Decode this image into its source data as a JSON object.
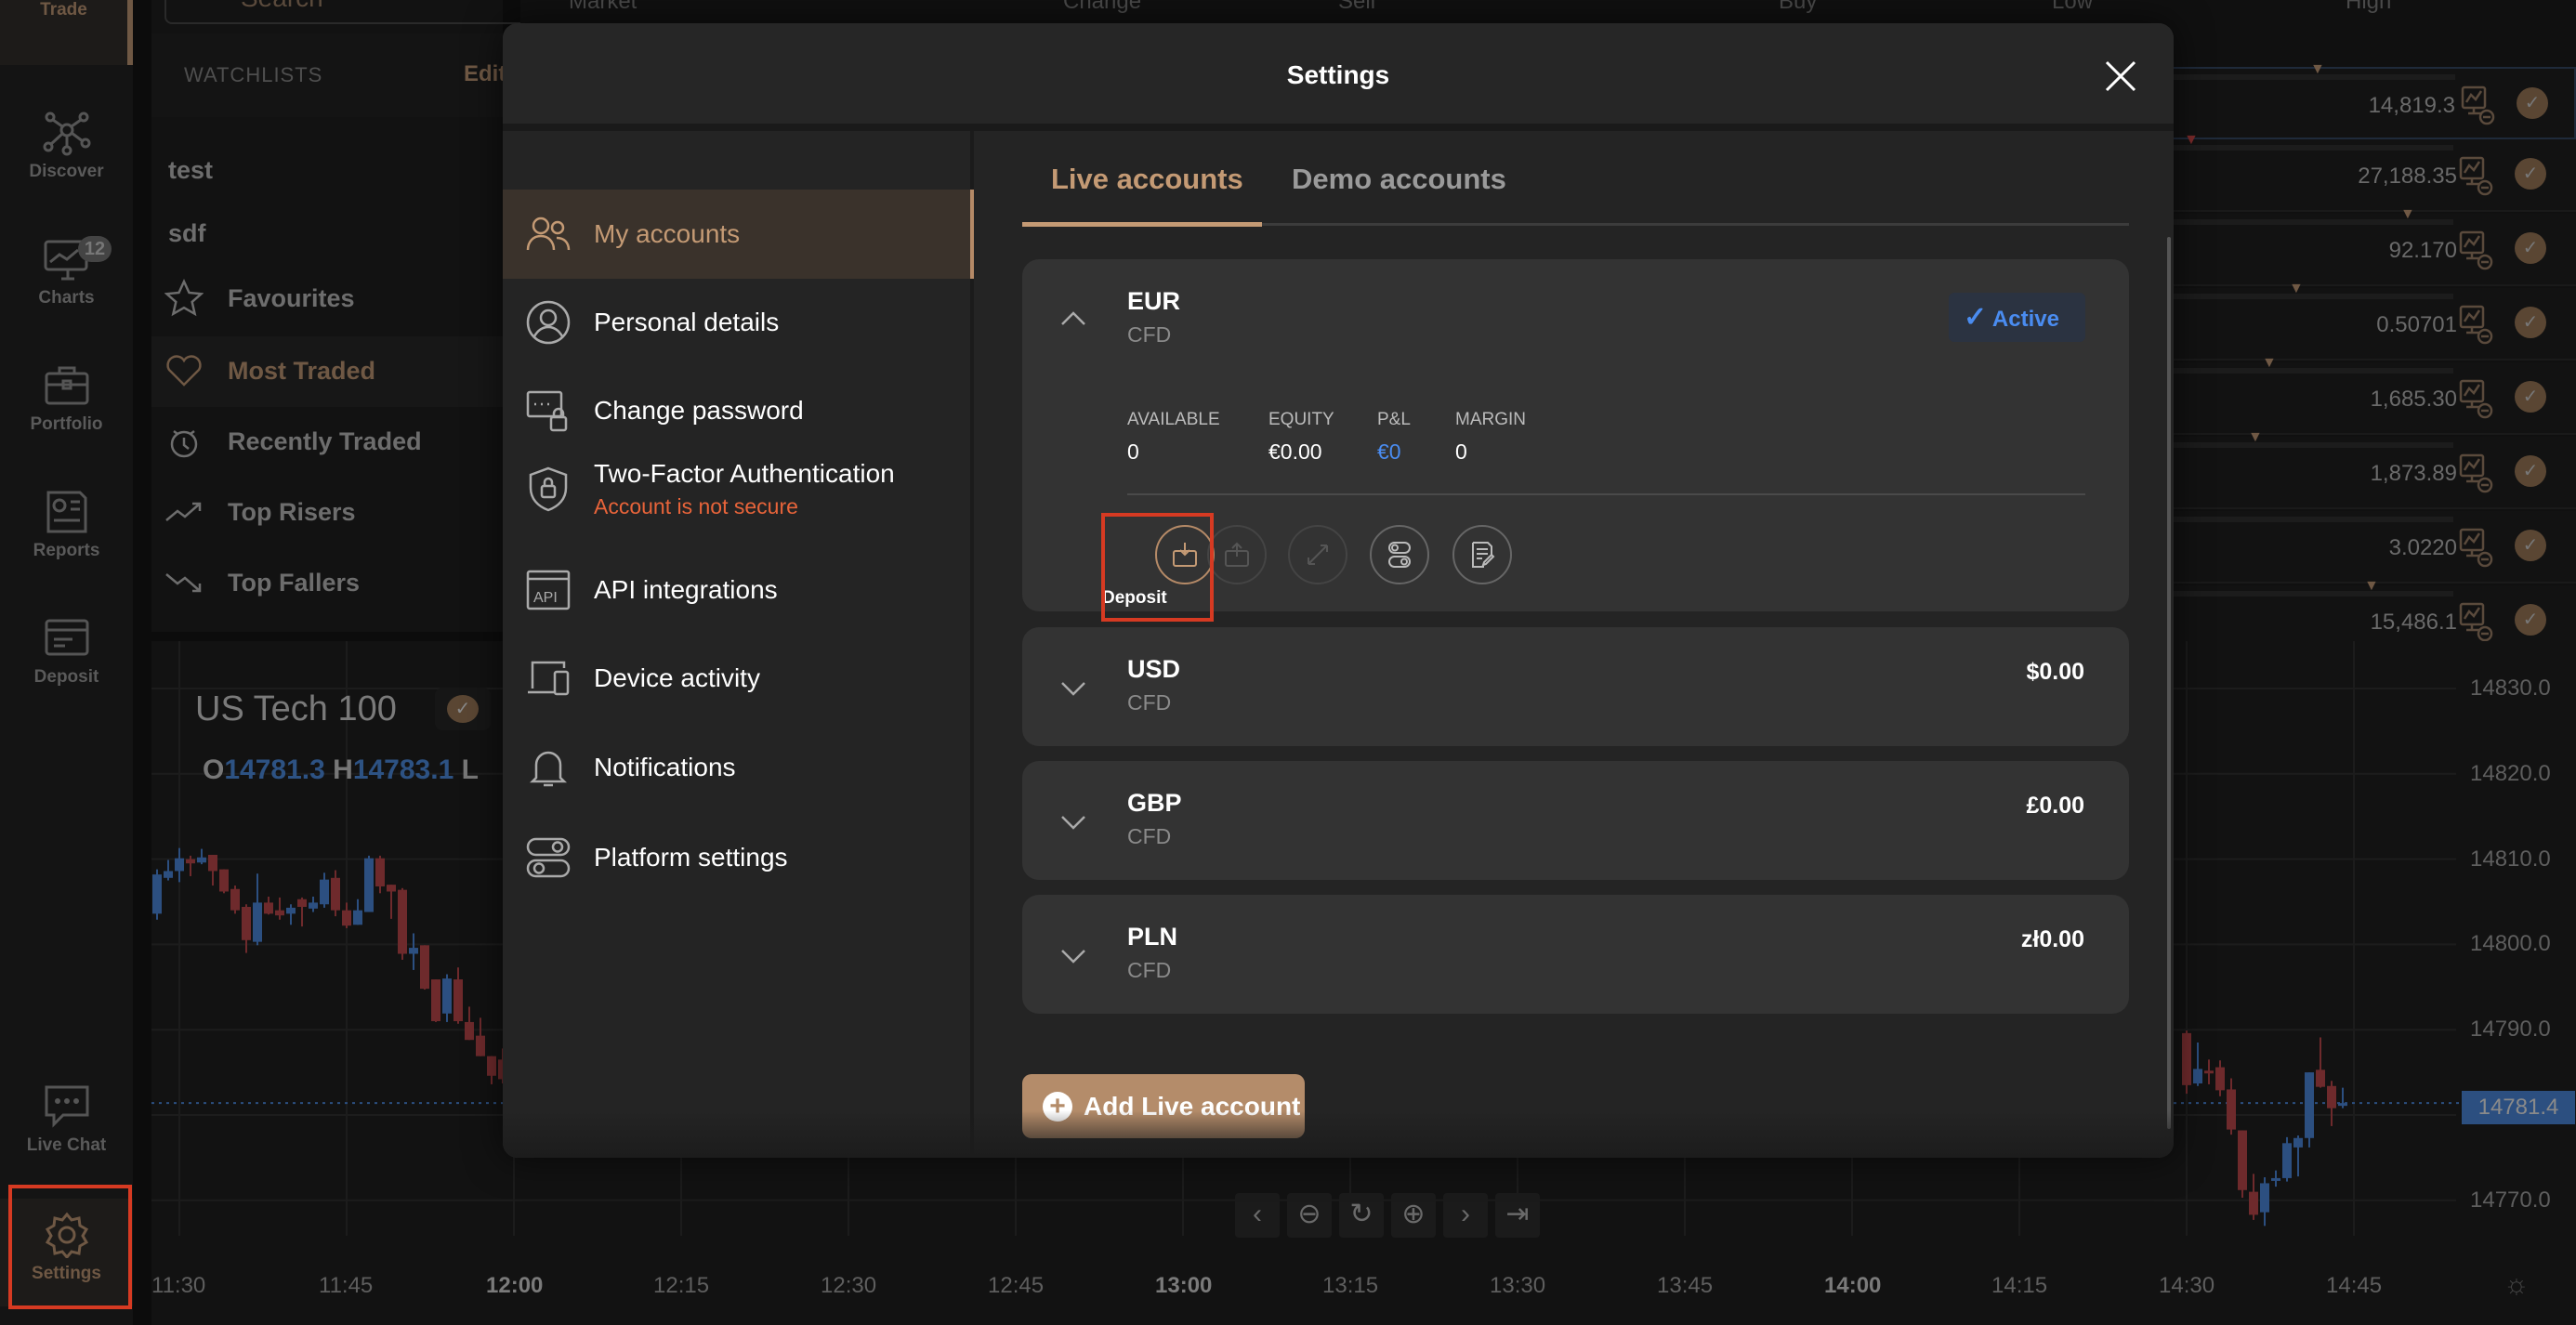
{
  "nav": {
    "items": [
      {
        "label": "Trade"
      },
      {
        "label": "Discover"
      },
      {
        "label": "Charts",
        "badge": "12"
      },
      {
        "label": "Portfolio"
      },
      {
        "label": "Reports"
      },
      {
        "label": "Deposit"
      },
      {
        "label": "Live Chat"
      },
      {
        "label": "Settings"
      }
    ]
  },
  "watchlist": {
    "search_placeholder": "Search",
    "header": "WATCHLISTS",
    "edit": "Edit",
    "items": [
      "test",
      "sdf",
      "Favourites",
      "Most Traded",
      "Recently Traded",
      "Top Risers",
      "Top Fallers"
    ]
  },
  "market": {
    "columns": [
      "Market",
      "Change",
      "Sell",
      "Buy",
      "Low",
      "High"
    ],
    "high_values": [
      "14,819.3",
      "27,188.35",
      "92.170",
      "0.50701",
      "1,685.30",
      "1,873.89",
      "3.0220",
      "15,486.1"
    ]
  },
  "chart": {
    "instrument": "US Tech 100",
    "ohlc": {
      "o_label": "O",
      "o": "14781.3",
      "h_label": "H",
      "h": "14783.1",
      "l_label": "L"
    },
    "price_ticks": [
      "14830.0",
      "14820.0",
      "14810.0",
      "14800.0",
      "14790.0",
      "14770.0"
    ],
    "last_price": "14781.4",
    "time_ticks": [
      "11:30",
      "11:45",
      "12:00",
      "12:15",
      "12:30",
      "12:45",
      "13:00",
      "13:15",
      "13:30",
      "13:45",
      "14:00",
      "14:15",
      "14:30",
      "14:45"
    ],
    "colors": {
      "up": "#2c4f80",
      "down": "#6e2a2c"
    },
    "candles_left_start": "11:28",
    "candles_left": [
      [
        14803.6,
        14808.8,
        14802.9,
        14808.2
      ],
      [
        14807.8,
        14809.9,
        14807.5,
        14808.6
      ],
      [
        14808.6,
        14811.3,
        14807.3,
        14810.1
      ],
      [
        14810,
        14810.4,
        14808,
        14809.5
      ],
      [
        14809.6,
        14811.2,
        14809.4,
        14810.2
      ],
      [
        14810.5,
        14810.5,
        14806.9,
        14808.6
      ],
      [
        14808.8,
        14808.8,
        14806,
        14806.2
      ],
      [
        14806.5,
        14806.9,
        14803.6,
        14804
      ],
      [
        14804.4,
        14804.7,
        14799,
        14800.5
      ],
      [
        14800.3,
        14808.3,
        14799.9,
        14804.9
      ],
      [
        14804.9,
        14805.6,
        14803.5,
        14803.6
      ],
      [
        14804,
        14805.5,
        14802.9,
        14803.4
      ],
      [
        14803.6,
        14804.7,
        14802.3,
        14804.3
      ],
      [
        14805.3,
        14805.5,
        14802.1,
        14804.4
      ],
      [
        14804.2,
        14805.6,
        14803.8,
        14804.9
      ],
      [
        14804.7,
        14808.4,
        14804.3,
        14807.6
      ],
      [
        14807.8,
        14808.7,
        14803.3,
        14804
      ],
      [
        14804,
        14804.9,
        14801.9,
        14802.2
      ],
      [
        14802.3,
        14805.3,
        14802.3,
        14804
      ],
      [
        14803.8,
        14810.4,
        14803.8,
        14810.1
      ],
      [
        14810.1,
        14810.4,
        14806,
        14806.8
      ],
      [
        14807,
        14807,
        14803,
        14806.2
      ],
      [
        14806.4,
        14806.6,
        14798.2,
        14798.9
      ],
      [
        14798.9,
        14801.3,
        14797,
        14799.6
      ],
      [
        14799.9,
        14799.9,
        14794.7,
        14794.8
      ],
      [
        14795.9,
        14795.9,
        14790.9,
        14791
      ],
      [
        14791.9,
        14796.5,
        14790.9,
        14796
      ],
      [
        14795.9,
        14797.3,
        14790.7,
        14791
      ],
      [
        14790.9,
        14792.7,
        14788.8,
        14788.8
      ],
      [
        14789.3,
        14791.4,
        14786.9,
        14786.9
      ],
      [
        14786.9,
        14786.9,
        14783.6,
        14784.6
      ],
      [
        14786.5,
        14787.8,
        14783.7,
        14784.2
      ]
    ],
    "candles_right_start": "14:30",
    "candles_right": [
      [
        14789.6,
        14789.9,
        14782.5,
        14783.5
      ],
      [
        14783.7,
        14788.5,
        14783.4,
        14785.4
      ],
      [
        14785.2,
        14786.5,
        14783.6,
        14784.9
      ],
      [
        14785.6,
        14786.4,
        14782.2,
        14782.9
      ],
      [
        14783,
        14784.3,
        14777.7,
        14778.3
      ],
      [
        14778.2,
        14778.2,
        14770.3,
        14771.2
      ],
      [
        14771,
        14773.1,
        14767.7,
        14768.3
      ],
      [
        14768.6,
        14772.7,
        14767,
        14772
      ],
      [
        14772.4,
        14773.5,
        14771.6,
        14772.6
      ],
      [
        14772.6,
        14777.4,
        14772.2,
        14776.7
      ],
      [
        14776.2,
        14777.6,
        14772.8,
        14777.3
      ],
      [
        14777.3,
        14785,
        14776.2,
        14785
      ],
      [
        14785.3,
        14789.1,
        14783.2,
        14783.3
      ],
      [
        14783.4,
        14784,
        14778.7,
        14780.8
      ],
      [
        14781.3,
        14783.2,
        14780.8,
        14781.4
      ]
    ]
  },
  "modal": {
    "title": "Settings",
    "sidebar": [
      {
        "label": "My accounts"
      },
      {
        "label": "Personal details"
      },
      {
        "label": "Change password"
      },
      {
        "label": "Two-Factor Authentication",
        "sub": "Account is not secure"
      },
      {
        "label": "API integrations"
      },
      {
        "label": "Device activity"
      },
      {
        "label": "Notifications"
      },
      {
        "label": "Platform settings"
      }
    ],
    "tabs": [
      "Live accounts",
      "Demo accounts"
    ],
    "accounts": [
      {
        "currency": "EUR",
        "type": "CFD",
        "status": "Active",
        "stats": [
          {
            "label": "AVAILABLE",
            "value": "0"
          },
          {
            "label": "EQUITY",
            "value": "€0.00"
          },
          {
            "label": "P&L",
            "value": "€0"
          },
          {
            "label": "MARGIN",
            "value": "0"
          }
        ],
        "deposit_label": "Deposit"
      },
      {
        "currency": "USD",
        "type": "CFD",
        "balance": "$0.00"
      },
      {
        "currency": "GBP",
        "type": "CFD",
        "balance": "£0.00"
      },
      {
        "currency": "PLN",
        "type": "CFD",
        "balance": "zł0.00"
      }
    ],
    "add_button": "Add Live account",
    "colors": {
      "accent": "#c49a74",
      "button": "#b48c6a",
      "active_blue": "#4a8cf0",
      "warning": "#e8643a"
    }
  }
}
